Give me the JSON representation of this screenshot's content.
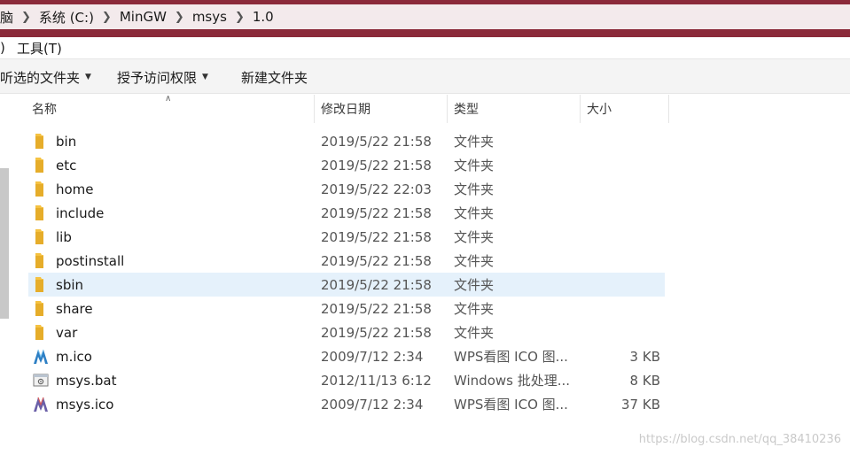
{
  "address": {
    "crumbs": [
      "脑",
      "系统 (C:)",
      "MinGW",
      "msys",
      "1.0"
    ]
  },
  "menubar": {
    "left_fragment": ")",
    "tools": "工具(T)"
  },
  "toolbar": {
    "filter_label": "听选的文件夹",
    "share_label": "授予访问权限",
    "new_folder_label": "新建文件夹"
  },
  "columns": {
    "name": "名称",
    "date": "修改日期",
    "type": "类型",
    "size": "大小"
  },
  "files": [
    {
      "name": "bin",
      "date": "2019/5/22 21:58",
      "type": "文件夹",
      "size": "",
      "icon": "folder-icon"
    },
    {
      "name": "etc",
      "date": "2019/5/22 21:58",
      "type": "文件夹",
      "size": "",
      "icon": "folder-icon"
    },
    {
      "name": "home",
      "date": "2019/5/22 22:03",
      "type": "文件夹",
      "size": "",
      "icon": "folder-icon"
    },
    {
      "name": "include",
      "date": "2019/5/22 21:58",
      "type": "文件夹",
      "size": "",
      "icon": "folder-icon"
    },
    {
      "name": "lib",
      "date": "2019/5/22 21:58",
      "type": "文件夹",
      "size": "",
      "icon": "folder-icon"
    },
    {
      "name": "postinstall",
      "date": "2019/5/22 21:58",
      "type": "文件夹",
      "size": "",
      "icon": "folder-icon"
    },
    {
      "name": "sbin",
      "date": "2019/5/22 21:58",
      "type": "文件夹",
      "size": "",
      "icon": "folder-icon",
      "selected": true
    },
    {
      "name": "share",
      "date": "2019/5/22 21:58",
      "type": "文件夹",
      "size": "",
      "icon": "folder-icon"
    },
    {
      "name": "var",
      "date": "2019/5/22 21:58",
      "type": "文件夹",
      "size": "",
      "icon": "folder-icon"
    },
    {
      "name": "m.ico",
      "date": "2009/7/12 2:34",
      "type": "WPS看图 ICO 图...",
      "size": "3 KB",
      "icon": "msys-ico-icon"
    },
    {
      "name": "msys.bat",
      "date": "2012/11/13 6:12",
      "type": "Windows 批处理...",
      "size": "8 KB",
      "icon": "batch-file-icon"
    },
    {
      "name": "msys.ico",
      "date": "2009/7/12 2:34",
      "type": "WPS看图 ICO 图...",
      "size": "37 KB",
      "icon": "msys-ico-icon"
    }
  ],
  "watermark": "https://blog.csdn.net/qq_38410236",
  "colors": {
    "title_accent": "#8b2a3a",
    "address_bg": "#f3eaec",
    "selected_row": "#e5f1fb",
    "folder": "#f5c242"
  }
}
